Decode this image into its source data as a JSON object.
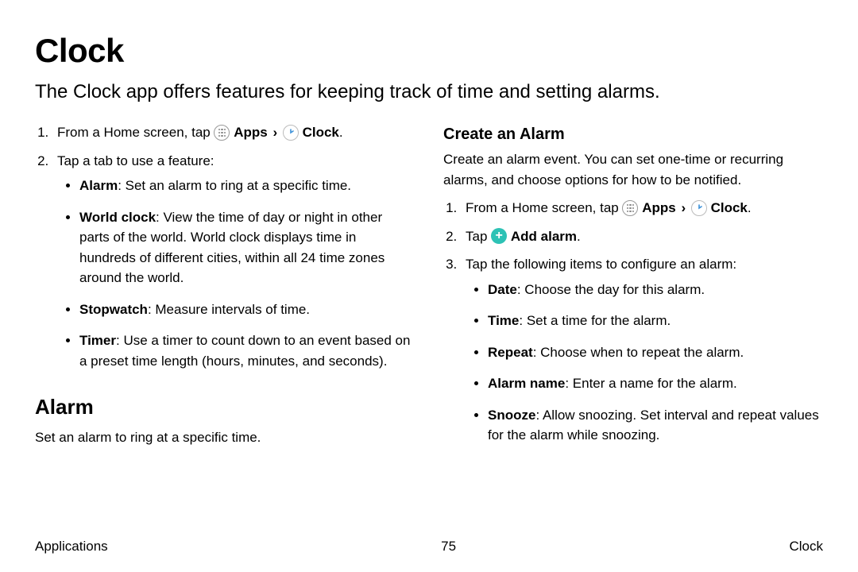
{
  "title": "Clock",
  "intro": "The Clock app offers features for keeping track of time and setting alarms.",
  "labels": {
    "apps": "Apps",
    "clock": "Clock",
    "add_alarm": "Add alarm"
  },
  "left": {
    "step1_prefix": "From a Home screen, tap ",
    "step2": "Tap a tab to use a feature:",
    "features": [
      {
        "name": "Alarm",
        "desc": ": Set an alarm to ring at a specific time."
      },
      {
        "name": "World clock",
        "desc": ": View the time of day or night in other parts of the world. World clock displays time in hundreds of different cities, within all 24 time zones around the world."
      },
      {
        "name": "Stopwatch",
        "desc": ": Measure intervals of time."
      },
      {
        "name": "Timer",
        "desc": ": Use a timer to count down to an event based on a preset time length (hours, minutes, and seconds)."
      }
    ],
    "alarm_heading": "Alarm",
    "alarm_desc": "Set an alarm to ring at a specific time."
  },
  "right": {
    "heading": "Create an Alarm",
    "intro": "Create an alarm event. You can set one-time or recurring alarms, and choose options for how to be notified.",
    "step1_prefix": "From a Home screen, tap ",
    "step2_prefix": "Tap ",
    "step3": "Tap the following items to configure an alarm:",
    "config_items": [
      {
        "name": "Date",
        "desc": ": Choose the day for this alarm."
      },
      {
        "name": "Time",
        "desc": ": Set a time for the alarm."
      },
      {
        "name": "Repeat",
        "desc": ": Choose when to repeat the alarm."
      },
      {
        "name": "Alarm name",
        "desc": ": Enter a name for the alarm."
      },
      {
        "name": "Snooze",
        "desc": ": Allow snoozing. Set interval and repeat values for the alarm while snoozing."
      }
    ]
  },
  "footer": {
    "left": "Applications",
    "page": "75",
    "right": "Clock"
  }
}
